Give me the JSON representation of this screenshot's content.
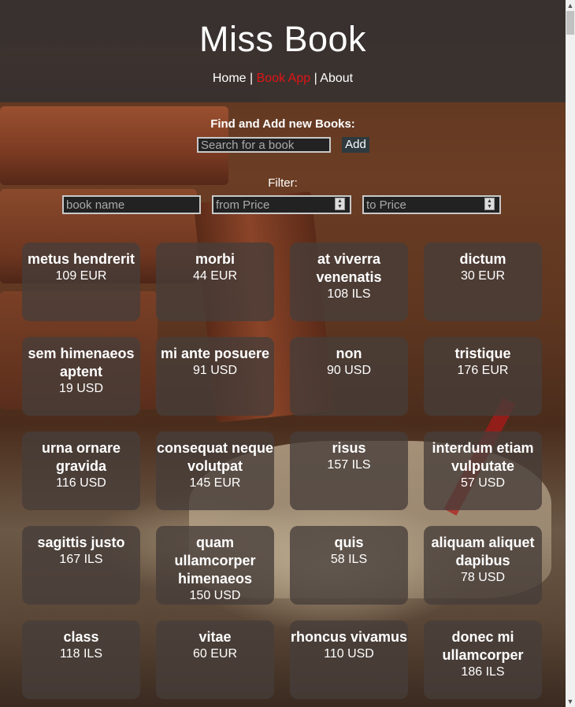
{
  "header": {
    "logo": "Miss Book",
    "nav": [
      {
        "label": "Home",
        "active": false
      },
      {
        "label": "Book App",
        "active": true
      },
      {
        "label": "About",
        "active": false
      }
    ],
    "separator": "|"
  },
  "add": {
    "title": "Find and Add new Books:",
    "search_placeholder": "Search for a book",
    "add_label": "Add"
  },
  "filter": {
    "label": "Filter:",
    "name_placeholder": "book name",
    "from_placeholder": "from Price",
    "to_placeholder": "to Price"
  },
  "books": [
    {
      "title": "metus hendrerit",
      "price": "109 EUR"
    },
    {
      "title": "morbi",
      "price": "44 EUR"
    },
    {
      "title": "at viverra venenatis",
      "price": "108 ILS"
    },
    {
      "title": "dictum",
      "price": "30 EUR"
    },
    {
      "title": "sem himenaeos aptent",
      "price": "19 USD"
    },
    {
      "title": "mi ante posuere",
      "price": "91 USD"
    },
    {
      "title": "non",
      "price": "90 USD"
    },
    {
      "title": "tristique",
      "price": "176 EUR"
    },
    {
      "title": "urna ornare gravida",
      "price": "116 USD"
    },
    {
      "title": "consequat neque volutpat",
      "price": "145 EUR"
    },
    {
      "title": "risus",
      "price": "157 ILS"
    },
    {
      "title": "interdum etiam vulputate",
      "price": "57 USD"
    },
    {
      "title": "sagittis justo",
      "price": "167 ILS"
    },
    {
      "title": "quam ullamcorper himenaeos",
      "price": "150 USD"
    },
    {
      "title": "quis",
      "price": "58 ILS"
    },
    {
      "title": "aliquam aliquet dapibus",
      "price": "78 USD"
    },
    {
      "title": "class",
      "price": "118 ILS"
    },
    {
      "title": "vitae",
      "price": "60 EUR"
    },
    {
      "title": "rhoncus vivamus",
      "price": "110 USD"
    },
    {
      "title": "donec mi ullamcorper",
      "price": "186 ILS"
    }
  ],
  "colors": {
    "active_link": "#e01515",
    "header_bg": "#373230",
    "card_bg": "#463e3a"
  }
}
